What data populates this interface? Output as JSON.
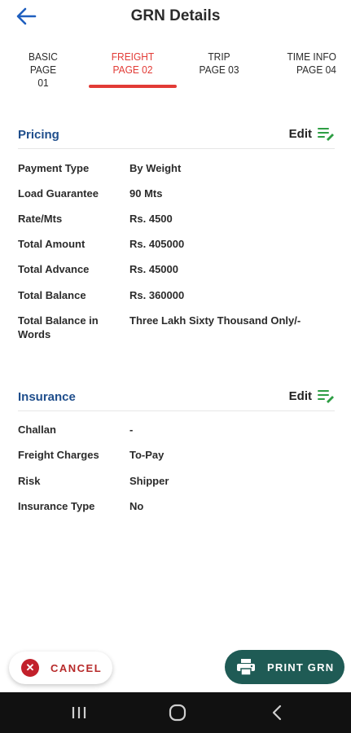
{
  "header": {
    "title": "GRN Details",
    "back_icon": "arrow-left-icon"
  },
  "tabs": [
    {
      "line1": "BASIC",
      "line2": "PAGE 01",
      "active": false
    },
    {
      "line1": "FREIGHT",
      "line2": "PAGE 02",
      "active": true
    },
    {
      "line1": "TRIP",
      "line2": "PAGE 03",
      "active": false
    },
    {
      "line1": "TIME INFO",
      "line2": "PAGE 04",
      "active": false
    }
  ],
  "pricing": {
    "title": "Pricing",
    "edit_label": "Edit",
    "rows": [
      {
        "label": "Payment Type",
        "value": "By Weight"
      },
      {
        "label": "Load Guarantee",
        "value": "90 Mts"
      },
      {
        "label": "Rate/Mts",
        "value": "Rs. 4500"
      },
      {
        "label": "Total Amount",
        "value": "Rs. 405000"
      },
      {
        "label": "Total Advance",
        "value": "Rs. 45000"
      },
      {
        "label": "Total Balance",
        "value": "Rs. 360000"
      },
      {
        "label": "Total Balance in Words",
        "value": "Three Lakh Sixty Thousand Only/-"
      }
    ]
  },
  "insurance": {
    "title": "Insurance",
    "edit_label": "Edit",
    "rows": [
      {
        "label": "Challan",
        "value": "-"
      },
      {
        "label": "Freight Charges",
        "value": "To-Pay"
      },
      {
        "label": "Risk",
        "value": "Shipper"
      },
      {
        "label": "Insurance Type",
        "value": "No"
      }
    ]
  },
  "actions": {
    "cancel_label": "CANCEL",
    "print_label": "PRINT GRN"
  },
  "colors": {
    "accent_red": "#e23b36",
    "section_blue": "#1f4e8c",
    "print_green": "#1f5b55",
    "edit_icon_green": "#2e9e44"
  }
}
